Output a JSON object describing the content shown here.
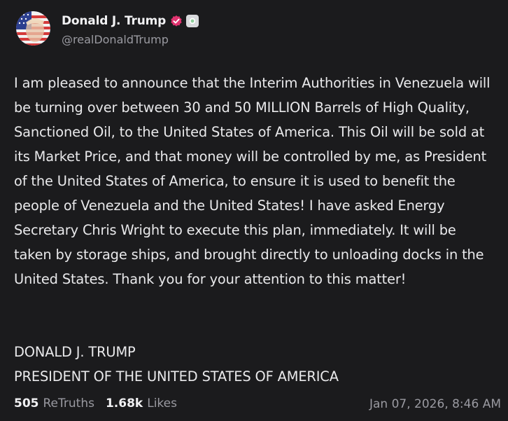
{
  "author": {
    "display_name": "Donald J. Trump",
    "handle": "@realDonaldTrump",
    "verified_color": "#e0336f"
  },
  "post": {
    "text": "I am pleased to announce that the Interim Authorities in Venezuela will be turning over between 30 and 50 MILLION Barrels of High Quality, Sanctioned Oil, to the United States of America. This Oil will be sold at its Market Price, and that money will be controlled by me, as President of the United States of America, to ensure it is used to benefit the people of Venezuela and the United States! I have asked Energy Secretary Chris Wright to execute this plan, immediately. It will be taken by storage ships, and brought directly to unloading docks in the United States. Thank you for your attention to this matter!",
    "signature_line1": "DONALD J. TRUMP",
    "signature_line2": "PRESIDENT OF THE UNITED STATES OF AMERICA"
  },
  "stats": {
    "retruths_count": "505",
    "retruths_label": "ReTruths",
    "likes_count": "1.68k",
    "likes_label": "Likes"
  },
  "timestamp": "Jan 07, 2026, 8:46 AM"
}
